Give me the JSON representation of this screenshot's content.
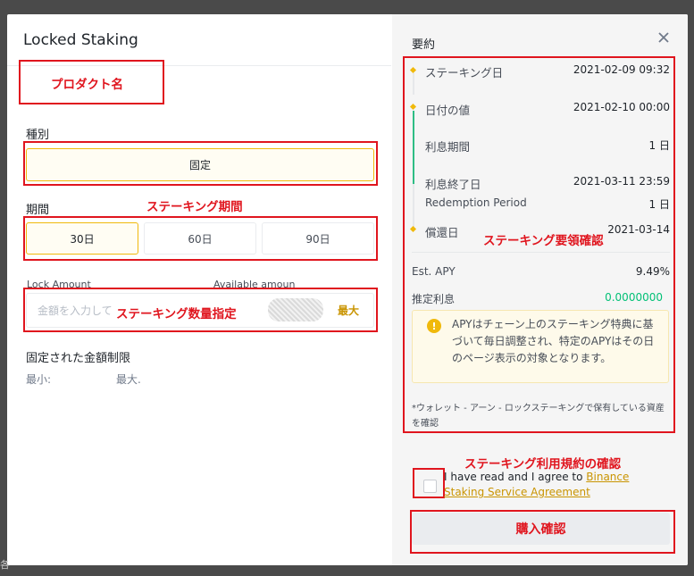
{
  "modal": {
    "title": "Locked Staking"
  },
  "form": {
    "type_label": "種別",
    "type_value": "固定",
    "period_label": "期間",
    "periods": [
      "30日",
      "60日",
      "90日"
    ],
    "lock_amount_label": "Lock Amount",
    "available_label": "Available amoun",
    "amount_placeholder": "金額を入力して",
    "max_label": "最大",
    "limit_title": "固定された金額制限",
    "min_label": "最小:",
    "max_limit_label": "最大."
  },
  "summary": {
    "title": "要約",
    "staking_date_label": "ステーキング日",
    "staking_date_value": "2021-02-09 09:32",
    "value_date_label": "日付の値",
    "value_date_value": "2021-02-10 00:00",
    "interest_period_label": "利息期間",
    "interest_period_value": "1 日",
    "interest_end_label": "利息終了日",
    "interest_end_value": "2021-03-11 23:59",
    "redemption_period_label": "Redemption Period",
    "redemption_period_value": "1 日",
    "redemption_date_label": "償還日",
    "redemption_date_value": "2021-03-14",
    "apy_label": "Est. APY",
    "apy_value": "9.49%",
    "est_interest_label": "推定利息",
    "est_interest_value": "0.0000000",
    "notice": "APYはチェーン上のステーキング特典に基づいて毎日調整され、特定のAPYはその日のページ表示の対象となります。",
    "footnote": "*ウォレット - アーン - ロックステーキングで保有している資産を確認"
  },
  "agreement": {
    "text": "I have read and I agree to ",
    "link": "Binance Staking Service Agreement"
  },
  "confirm_button": "購入確認",
  "annotations": {
    "product_name": "プロダクト名",
    "staking_period": "ステーキング期間",
    "amount": "ステーキング数量指定",
    "summary_check": "ステーキング要領確認",
    "terms": "ステーキング利用規約の確認"
  },
  "colors": {
    "accent": "#f0b90b",
    "annotation_red": "#e0151e",
    "positive_green": "#02c076",
    "timeline_green": "#2ebd85"
  },
  "edge_char": "各"
}
